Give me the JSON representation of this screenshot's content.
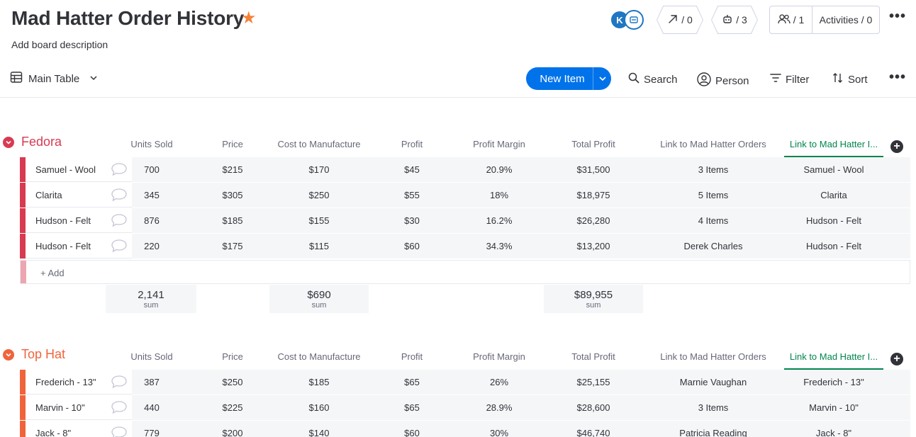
{
  "board": {
    "title": "Mad Hatter Order History",
    "description": "Add board description"
  },
  "header": {
    "avatar_initial": "K",
    "automations_count": "/ 0",
    "integrations_count": "/ 3",
    "members_count": "/ 1",
    "activities_label": "Activities / 0"
  },
  "toolbar": {
    "view_label": "Main Table",
    "new_item_label": "New Item",
    "search_label": "Search",
    "person_label": "Person",
    "filter_label": "Filter",
    "sort_label": "Sort"
  },
  "columns": [
    "Units Sold",
    "Price",
    "Cost to Manufacture",
    "Profit",
    "Profit Margin",
    "Total Profit",
    "Link to Mad Hatter Orders",
    "Link to Mad Hatter I..."
  ],
  "colors": {
    "accent": "#0073ea",
    "fedora": "#e2445c",
    "top_hat": "#ff7575"
  },
  "groups": [
    {
      "title": "Fedora",
      "color": "#d83a52",
      "add_label": "+ Add",
      "rows": [
        {
          "name": "Samuel - Wool",
          "cells": [
            "700",
            "$215",
            "$170",
            "$45",
            "20.9%",
            "$31,500",
            "3 Items",
            "Samuel - Wool"
          ]
        },
        {
          "name": "Clarita",
          "cells": [
            "345",
            "$305",
            "$250",
            "$55",
            "18%",
            "$18,975",
            "5 Items",
            "Clarita"
          ]
        },
        {
          "name": "Hudson - Felt",
          "cells": [
            "876",
            "$185",
            "$155",
            "$30",
            "16.2%",
            "$26,280",
            "4 Items",
            "Hudson - Felt"
          ]
        },
        {
          "name": "Hudson - Felt",
          "cells": [
            "220",
            "$175",
            "$115",
            "$60",
            "34.3%",
            "$13,200",
            "Derek Charles",
            "Hudson - Felt"
          ]
        }
      ],
      "sums": [
        {
          "value": "2,141",
          "label": "sum"
        },
        {
          "value": "$690",
          "label": "sum"
        },
        {
          "value": "$89,955",
          "label": "sum"
        }
      ]
    },
    {
      "title": "Top Hat",
      "color": "#f0643c",
      "rows": [
        {
          "name": "Frederich - 13\"",
          "cells": [
            "387",
            "$250",
            "$185",
            "$65",
            "26%",
            "$25,155",
            "Marnie Vaughan",
            "Frederich - 13\""
          ]
        },
        {
          "name": "Marvin - 10\"",
          "cells": [
            "440",
            "$225",
            "$160",
            "$65",
            "28.9%",
            "$28,600",
            "3 Items",
            "Marvin - 10\""
          ]
        },
        {
          "name": "Jack - 8\"",
          "cells": [
            "779",
            "$200",
            "$140",
            "$60",
            "30%",
            "$46,740",
            "Patricia Reading",
            "Jack - 8\""
          ]
        }
      ]
    }
  ]
}
